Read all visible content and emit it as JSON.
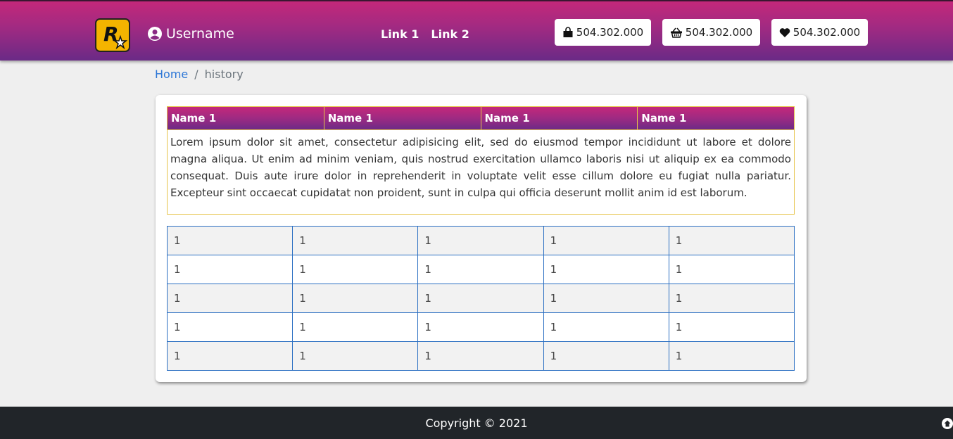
{
  "header": {
    "username": "Username",
    "links": [
      "Link 1",
      "Link 2"
    ],
    "stats": [
      {
        "icon": "shopping-bag-icon",
        "value": "504.302.000"
      },
      {
        "icon": "basket-icon",
        "value": "504.302.000"
      },
      {
        "icon": "heart-icon",
        "value": "504.302.000"
      }
    ]
  },
  "breadcrumb": {
    "home": "Home",
    "separator": "/",
    "current": "history"
  },
  "info_table": {
    "headers": [
      "Name 1",
      "Name 1",
      "Name 1",
      "Name 1"
    ],
    "body": "Lorem ipsum dolor sit amet, consectetur adipisicing elit, sed do eiusmod tempor incididunt ut labore et dolore magna aliqua. Ut enim ad minim veniam, quis nostrud exercitation ullamco laboris nisi ut aliquip ex ea commodo consequat. Duis aute irure dolor in reprehenderit in voluptate velit esse cillum dolore eu fugiat nulla pariatur. Excepteur sint occaecat cupidatat non proident, sunt in culpa qui officia deserunt mollit anim id est laborum."
  },
  "grid": {
    "rows": [
      [
        "1",
        "1",
        "1",
        "1",
        "1"
      ],
      [
        "1",
        "1",
        "1",
        "1",
        "1"
      ],
      [
        "1",
        "1",
        "1",
        "1",
        "1"
      ],
      [
        "1",
        "1",
        "1",
        "1",
        "1"
      ],
      [
        "1",
        "1",
        "1",
        "1",
        "1"
      ]
    ]
  },
  "footer": {
    "copyright": "Copyright © 2021"
  },
  "colors": {
    "brand_top": "#c4287a",
    "brand_bottom": "#6a2a86",
    "link": "#2c76d6"
  }
}
